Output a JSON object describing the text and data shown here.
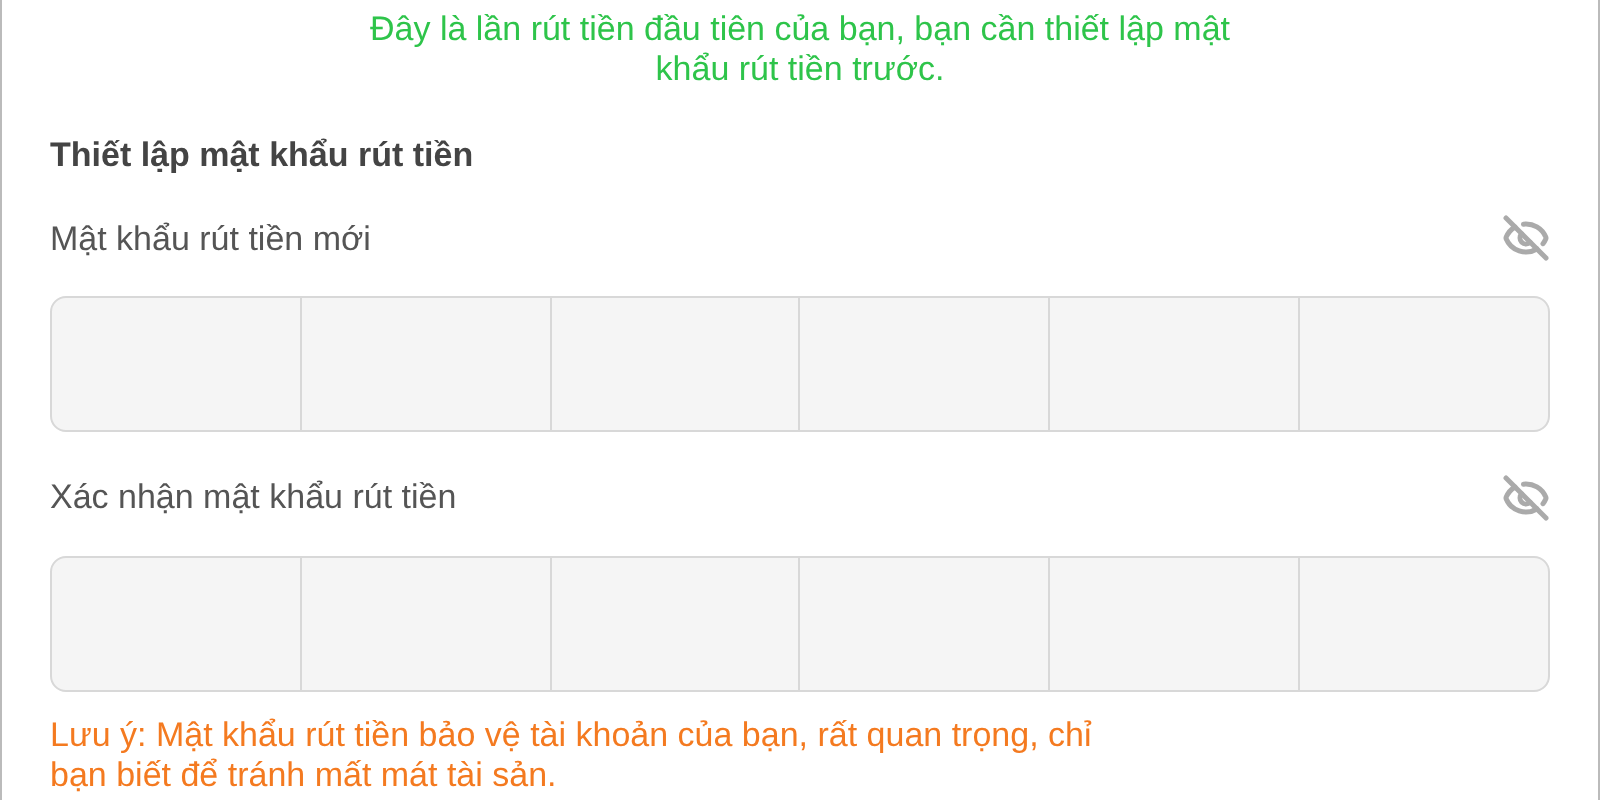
{
  "notice": "Đây là lần rút tiền đầu tiên của bạn, bạn cần thiết lập mật khẩu rút tiền trước.",
  "heading": "Thiết lập mật khẩu rút tiền",
  "fields": [
    {
      "label": "Mật khẩu rút tiền mới",
      "visible": false
    },
    {
      "label": "Xác nhận mật khẩu rút tiền",
      "visible": false
    }
  ],
  "note": "Lưu ý: Mật khẩu rút tiền bảo vệ tài khoản của bạn, rất quan trọng, chỉ bạn biết để tránh mất mát tài sản."
}
